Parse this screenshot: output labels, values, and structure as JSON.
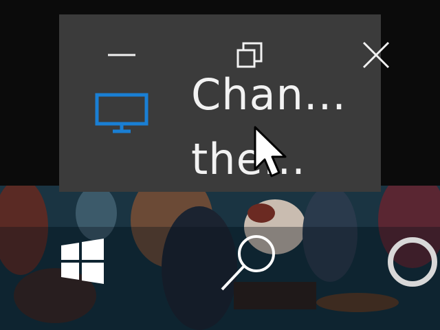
{
  "thumbnail": {
    "title_line1": "Chan...",
    "title_line2": "the...",
    "app_icon": "monitor-icon",
    "controls": {
      "minimize_icon": "minimize-icon",
      "restore_icon": "restore-icon",
      "close_icon": "close-icon"
    }
  },
  "taskbar": {
    "start_icon": "windows-logo-icon",
    "search_icon": "search-icon",
    "cortana_icon": "cortana-ring-icon"
  },
  "colors": {
    "popup_bg": "#3b3b3b",
    "accent_blue": "#1a7fd4",
    "text": "#f2f2f2",
    "wallpaper": "#102c3a"
  }
}
